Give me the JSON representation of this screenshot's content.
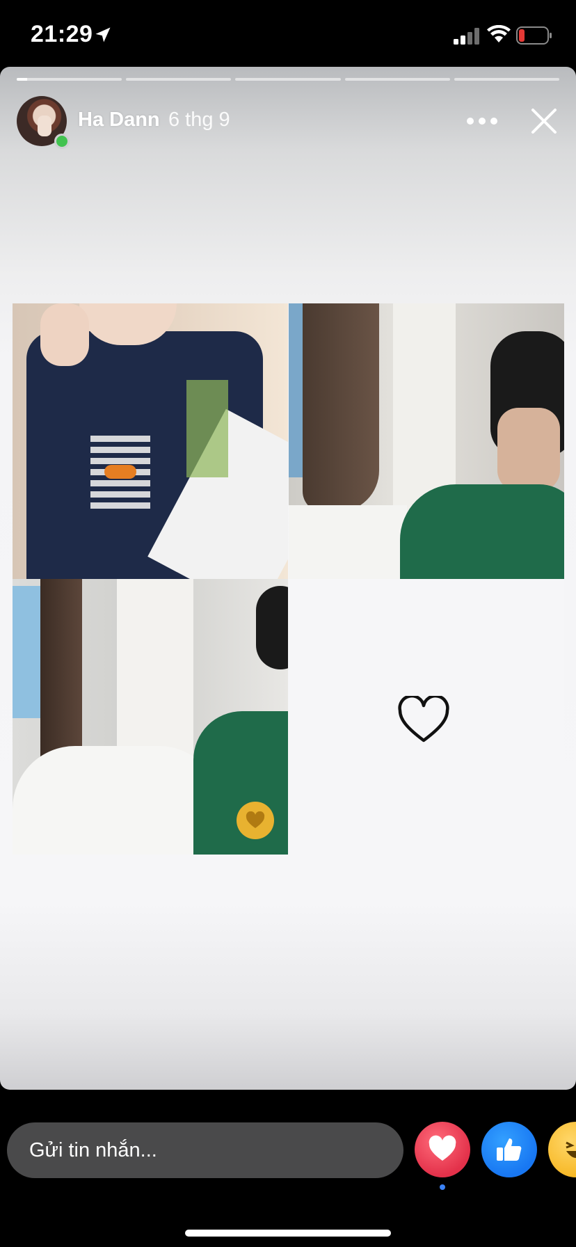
{
  "status_bar": {
    "time": "21:29",
    "icons": [
      "location-arrow-icon",
      "cellular-signal-icon",
      "wifi-icon",
      "battery-low-icon"
    ],
    "battery_color": "#e53935"
  },
  "story": {
    "author_name": "Ha Dann",
    "posted_date": "6 thg 9",
    "online_status_color": "#42c350",
    "progress": {
      "segments": 5,
      "current_segment": 1,
      "current_fill_fraction": 0.1
    },
    "collage": {
      "photos": [
        "photo-1",
        "photo-2",
        "photo-3"
      ],
      "empty_cell_icon": "heart-outline-icon",
      "sticker_icon": "gold-heart-icon",
      "sticker_color": "#e8b230"
    }
  },
  "footer": {
    "message_placeholder": "Gửi tin nhắn...",
    "reactions": [
      "love-icon",
      "like-icon",
      "haha-icon"
    ],
    "reaction_colors": {
      "love": "#e3314a",
      "like": "#1877f2",
      "haha": "#f7b928"
    }
  }
}
